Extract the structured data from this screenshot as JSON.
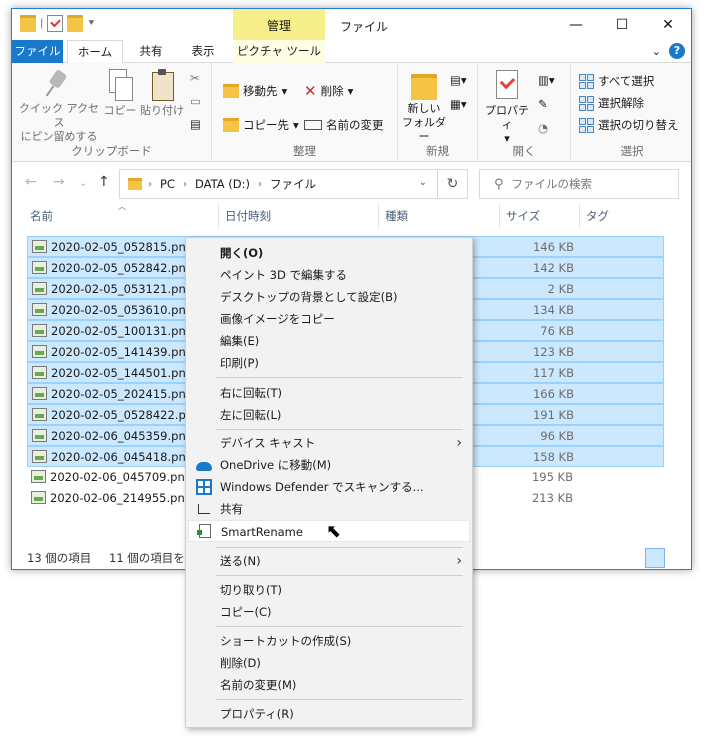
{
  "titlebar": {
    "context_tab_header": "管理",
    "title": "ファイル",
    "controls": {
      "minimize": "—",
      "maximize": "☐",
      "close": "✕"
    }
  },
  "ribbon_tabs": {
    "file": "ファイル",
    "home": "ホーム",
    "share": "共有",
    "view": "表示",
    "picture_tools": "ピクチャ ツール",
    "collapse": "⌄",
    "help": "?"
  },
  "ribbon": {
    "clipboard": {
      "label": "クリップボード",
      "pin_line1": "クイック アクセス",
      "pin_line2": "にピン留めする",
      "copy": "コピー",
      "paste": "貼り付け"
    },
    "organize": {
      "label": "整理",
      "move_to": "移動先",
      "copy_to": "コピー先",
      "delete": "削除",
      "rename": "名前の変更"
    },
    "new": {
      "label": "新規",
      "new_folder_line1": "新しい",
      "new_folder_line2": "フォルダー"
    },
    "open": {
      "label": "開く",
      "properties": "プロパティ"
    },
    "select": {
      "label": "選択",
      "select_all": "すべて選択",
      "select_none": "選択解除",
      "invert": "選択の切り替え"
    }
  },
  "address": {
    "crumbs": [
      "PC",
      "DATA (D:)",
      "ファイル"
    ],
    "search_placeholder": "ファイルの検索"
  },
  "columns": {
    "name": "名前",
    "date": "日付時刻",
    "type": "種類",
    "size": "サイズ",
    "tag": "タグ"
  },
  "files": [
    {
      "name": "2020-02-05_052815.png",
      "size": "146 KB",
      "selected": true
    },
    {
      "name": "2020-02-05_052842.png",
      "size": "142 KB",
      "selected": true
    },
    {
      "name": "2020-02-05_053121.png",
      "size": "2 KB",
      "selected": true
    },
    {
      "name": "2020-02-05_053610.png",
      "size": "134 KB",
      "selected": true
    },
    {
      "name": "2020-02-05_100131.png",
      "size": "76 KB",
      "selected": true
    },
    {
      "name": "2020-02-05_141439.png",
      "size": "123 KB",
      "selected": true
    },
    {
      "name": "2020-02-05_144501.png",
      "size": "117 KB",
      "selected": true
    },
    {
      "name": "2020-02-05_202415.png",
      "size": "166 KB",
      "selected": true
    },
    {
      "name": "2020-02-05_0528422.png",
      "size": "191 KB",
      "selected": true
    },
    {
      "name": "2020-02-06_045359.png",
      "size": "96 KB",
      "selected": true
    },
    {
      "name": "2020-02-06_045418.png",
      "size": "158 KB",
      "selected": true
    },
    {
      "name": "2020-02-06_045709.png",
      "size": "195 KB",
      "selected": false
    },
    {
      "name": "2020-02-06_214955.png",
      "size": "213 KB",
      "selected": false
    }
  ],
  "status": {
    "item_count": "13 個の項目",
    "selected_count": "11 個の項目を選"
  },
  "context_menu": {
    "open": "開く(O)",
    "paint3d": "ペイント 3D で編集する",
    "set_background": "デスクトップの背景として設定(B)",
    "copy_image": "画像イメージをコピー",
    "edit": "編集(E)",
    "print": "印刷(P)",
    "rotate_right": "右に回転(T)",
    "rotate_left": "左に回転(L)",
    "cast": "デバイス キャスト",
    "onedrive": "OneDrive に移動(M)",
    "defender": "Windows Defender でスキャンする...",
    "share": "共有",
    "smartrename": "SmartRename",
    "send_to": "送る(N)",
    "cut": "切り取り(T)",
    "copy": "コピー(C)",
    "create_shortcut": "ショートカットの作成(S)",
    "delete": "削除(D)",
    "rename": "名前の変更(M)",
    "properties": "プロパティ(R)"
  }
}
